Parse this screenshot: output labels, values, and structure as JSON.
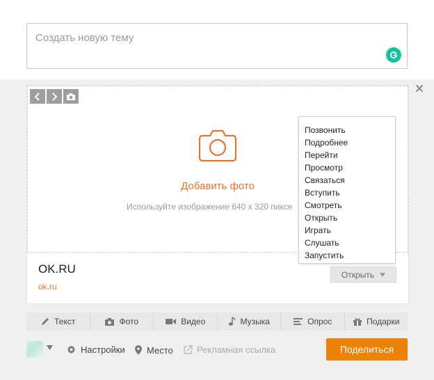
{
  "topic": {
    "placeholder": "Создать новую тему"
  },
  "media": {
    "add_photo_label": "Добавить фото",
    "hint": "Используйте изображение 640 x 320 пиксе"
  },
  "link": {
    "title": "OK.RU",
    "url": "ok.ru",
    "button_label": "Открыть"
  },
  "dropdown": {
    "items": [
      "Позвонить",
      "Подробнее",
      "Перейти",
      "Просмотр",
      "Связаться",
      "Вступить",
      "Смотреть",
      "Открыть",
      "Играть",
      "Слушать",
      "Запустить"
    ]
  },
  "tabs": [
    {
      "label": "Текст",
      "icon": "pencil-icon"
    },
    {
      "label": "Фото",
      "icon": "camera-icon"
    },
    {
      "label": "Видео",
      "icon": "video-icon"
    },
    {
      "label": "Музыка",
      "icon": "music-note-icon"
    },
    {
      "label": "Опрос",
      "icon": "poll-icon"
    },
    {
      "label": "Подарки",
      "icon": "gift-icon"
    }
  ],
  "footer": {
    "settings_label": "Настройки",
    "place_label": "Место",
    "ad_link_label": "Рекламная ссылка",
    "share_label": "Поделиться"
  },
  "colors": {
    "accent": "#eb722e",
    "share_button": "#ee8208",
    "grammarly": "#15c39a"
  }
}
